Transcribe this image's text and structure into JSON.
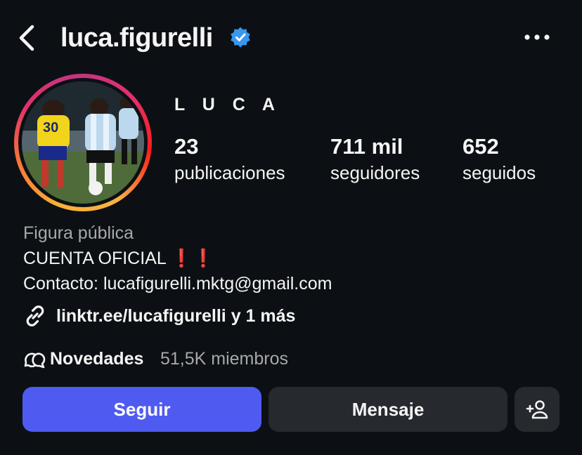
{
  "header": {
    "username": "luca.figurelli",
    "back_icon": "chevron-left-icon",
    "verified_icon": "verified-badge-icon",
    "more_icon": "more-horizontal-icon"
  },
  "profile": {
    "display_name": "L U C A",
    "stats": [
      {
        "value": "23",
        "label": "publicaciones"
      },
      {
        "value": "711 mil",
        "label": "seguidores"
      },
      {
        "value": "652",
        "label": "seguidos"
      }
    ],
    "category": "Figura pública",
    "bio_line1": "CUENTA OFICIAL ❗️❗️",
    "bio_line2": "Contacto: lucafigurelli.mktg@gmail.com",
    "link": "linktr.ee/lucafigurelli y 1 más"
  },
  "channel": {
    "name": "Novedades",
    "members": "51,5K miembros"
  },
  "actions": {
    "follow": "Seguir",
    "message": "Mensaje",
    "add_icon": "add-person-icon"
  },
  "colors": {
    "background": "#0c1014",
    "follow_button": "#4f5bf0",
    "secondary_button": "#26292e",
    "verified": "#3897f0",
    "muted_text": "#a8a8a8"
  }
}
